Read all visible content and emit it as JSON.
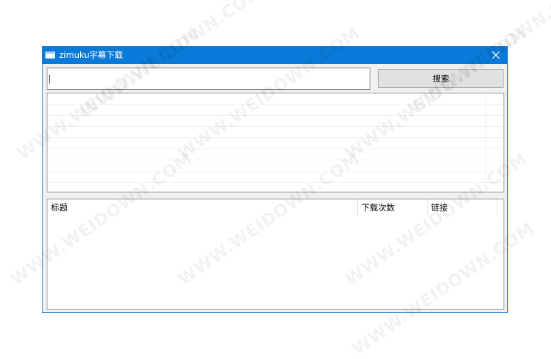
{
  "window": {
    "title": "zimuku字幕下载"
  },
  "search": {
    "value": "",
    "button_label": "搜索"
  },
  "detail_list": {
    "columns": [
      "标题",
      "下载次数",
      "链接"
    ]
  },
  "watermark": "WWW.WEIDOWN.COM",
  "colors": {
    "titlebar": "#0a7ad8",
    "window_bg": "#f0f0f0",
    "button_bg": "#e1e1e1"
  }
}
